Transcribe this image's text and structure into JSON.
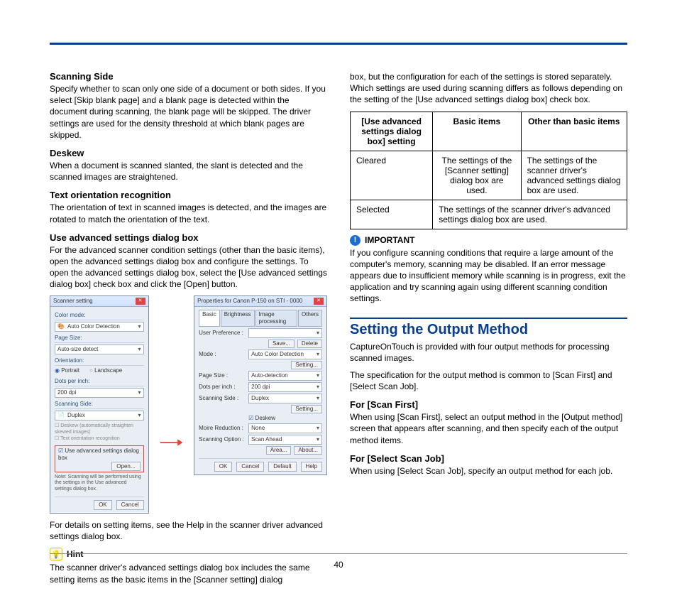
{
  "page_number": "40",
  "left": {
    "scanning_side": {
      "title": "Scanning Side",
      "body": "Specify whether to scan only one side of a document or both sides. If you select [Skip blank page] and a blank page is detected within the document during scanning, the blank page will be skipped. The driver settings are used for the density threshold at which blank pages are skipped."
    },
    "deskew": {
      "title": "Deskew",
      "body": "When a document is scanned slanted, the slant is detected and the scanned images are straightened."
    },
    "text_orient": {
      "title": "Text orientation recognition",
      "body": "The orientation of text in scanned images is detected, and the images are rotated to match the orientation of the text."
    },
    "adv_settings": {
      "title": "Use advanced settings dialog box",
      "body": "For the advanced scanner condition settings (other than the basic items), open the advanced settings dialog box and configure the settings. To open the advanced settings dialog box, select the [Use advanced settings dialog box] check box and click the [Open] button."
    },
    "dlg1": {
      "title": "Scanner setting",
      "color_mode_label": "Color mode:",
      "color_mode_val": "Auto Color Detection",
      "page_size_label": "Page Size:",
      "page_size_val": "Auto-size detect",
      "orientation_label": "Orientation:",
      "portrait": "Portrait",
      "landscape": "Landscape",
      "dpi_label": "Dots per inch:",
      "dpi_val": "200 dpi",
      "scan_side_label": "Scanning Side:",
      "scan_side_val": "Duplex",
      "deskew_chk": "Deskew (automatically straighten skewed images)",
      "text_chk": "Text orientation recognition",
      "adv_chk": "Use advanced settings dialog box",
      "open_btn": "Open...",
      "note": "Note: Scanning will be performed using the settings in the Use advanced settings dialog box.",
      "ok": "OK",
      "cancel": "Cancel"
    },
    "dlg2": {
      "title": "Properties for Canon P-150 on STI - 0000",
      "tabs": {
        "basic": "Basic",
        "brightness": "Brightness",
        "image": "Image processing",
        "others": "Others"
      },
      "user_pref": "User Preference :",
      "save": "Save...",
      "delete": "Delete",
      "mode_label": "Mode :",
      "mode_val": "Auto Color Detection",
      "setting": "Setting...",
      "page_size_label": "Page Size :",
      "page_size_val": "Auto-detection",
      "dpi_label": "Dots per inch :",
      "dpi_val": "200 dpi",
      "scan_side_label": "Scanning Side :",
      "scan_side_val": "Duplex",
      "setting2": "Setting...",
      "deskew_chk": "Deskew",
      "moire_label": "Moire Reduction :",
      "moire_val": "None",
      "scan_opt_label": "Scanning Option :",
      "scan_opt_val": "Scan Ahead",
      "area": "Area...",
      "about": "About...",
      "ok": "OK",
      "cancel": "Cancel",
      "default": "Default",
      "help": "Help"
    },
    "after_dialogs": "For details on setting items, see the Help in the scanner driver advanced settings dialog box.",
    "hint_label": "Hint",
    "hint_body": "The scanner driver's advanced settings dialog box includes the same setting items as the basic items in the [Scanner setting] dialog"
  },
  "right": {
    "cont_para": "box, but the configuration for each of the settings is stored separately. Which settings are used during scanning differs as follows depending on the setting of the [Use advanced settings dialog box] check box.",
    "table": {
      "h1": "[Use advanced settings dialog box] setting",
      "h2": "Basic items",
      "h3": "Other than basic items",
      "r1c1": "Cleared",
      "r1c2": "The settings of the [Scanner setting] dialog box are used.",
      "r1c3": "The settings of the scanner driver's advanced settings dialog box are used.",
      "r2c1": "Selected",
      "r2c23": "The settings of the scanner driver's advanced settings dialog box are used."
    },
    "important_label": "IMPORTANT",
    "important_body": "If you configure scanning conditions that require a large amount of the computer's memory, scanning may be disabled. If an error message appears due to insufficient memory while scanning is in progress, exit the application and try scanning again using different scanning condition settings.",
    "h2": "Setting the Output Method",
    "h2_body1": "CaptureOnTouch is provided with four output methods for processing scanned images.",
    "h2_body2": "The specification for the output method is common to [Scan First] and [Select Scan Job].",
    "scan_first": {
      "title": "For [Scan First]",
      "body": "When using [Scan First], select an output method in the [Output method] screen that appears after scanning, and then specify each of the output method items."
    },
    "select_job": {
      "title": "For [Select Scan Job]",
      "body": "When using [Select Scan Job], specify an output method for each job."
    }
  }
}
